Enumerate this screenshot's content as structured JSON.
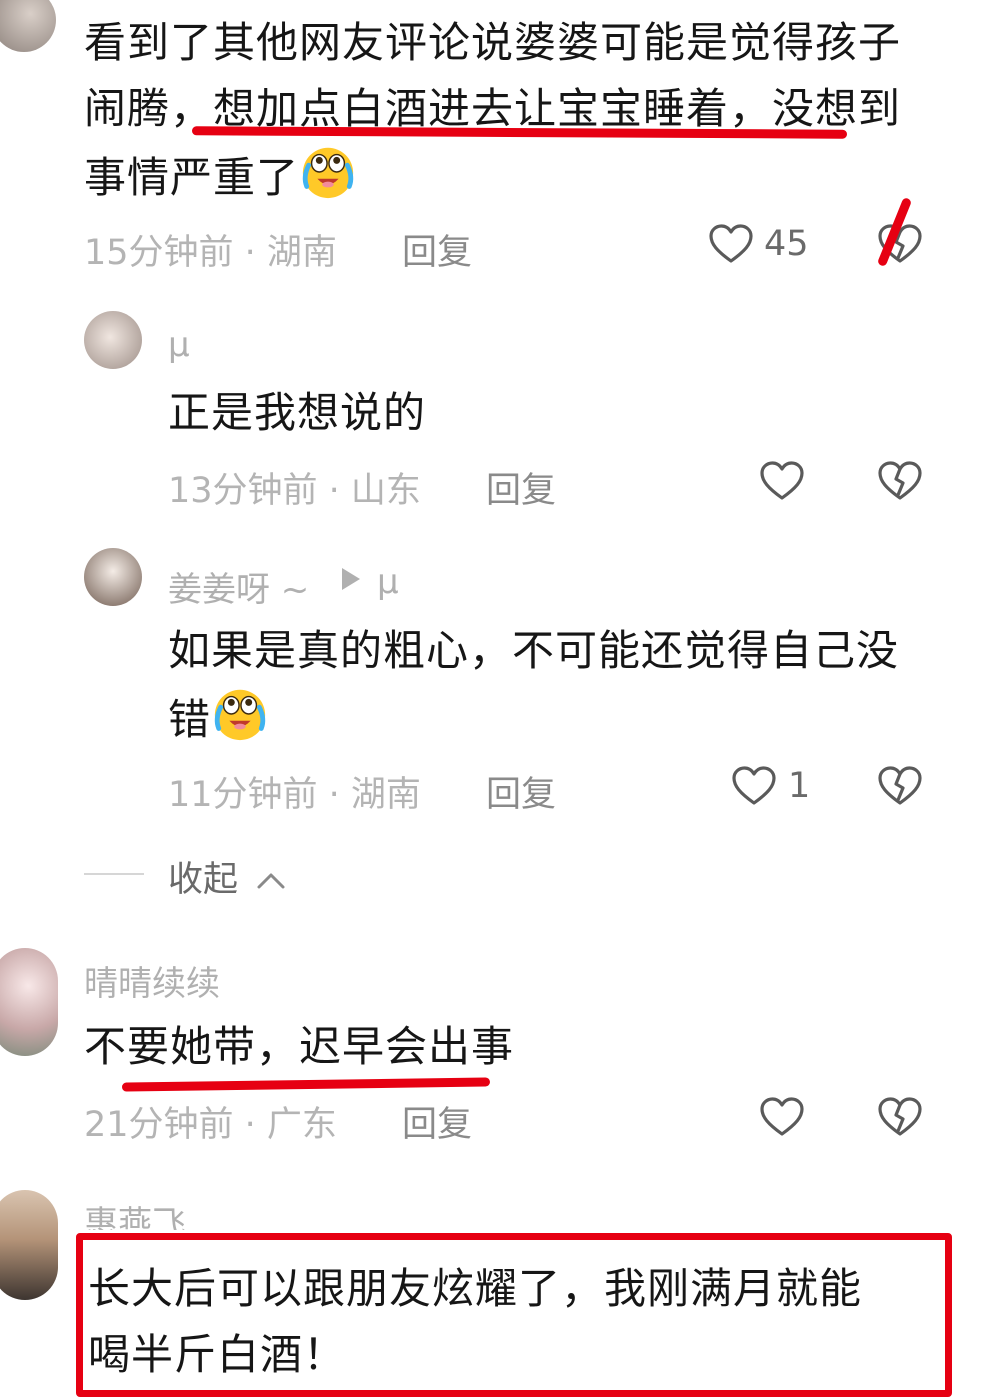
{
  "comments": [
    {
      "text": "看到了其他网友评论说婆婆可能是觉得孩子闹腾，想加点白酒进去让宝宝睡着，没想到事情严重了",
      "meta": "15分钟前 · 湖南",
      "reply_label": "回复",
      "likes": "45",
      "emoji": "crying-laughing-emoji"
    },
    {
      "username": "μ",
      "text": "正是我想说的",
      "meta": "13分钟前 · 山东",
      "reply_label": "回复"
    },
    {
      "username": "姜姜呀 ~",
      "reply_to": "μ",
      "text_line1": "如果是真的粗心，不可能还觉得自己没",
      "text_line2": "错",
      "meta": "11分钟前 · 湖南",
      "reply_label": "回复",
      "likes": "1",
      "emoji": "crying-laughing-emoji"
    },
    {
      "username": "晴晴续续",
      "text": "不要她带，迟早会出事",
      "meta": "21分钟前 · 广东",
      "reply_label": "回复"
    },
    {
      "username": "惠燕飞",
      "text_line1": "长大后可以跟朋友炫耀了，我刚满月就能",
      "text_line2": "喝半斤白酒！"
    }
  ],
  "collapse_label": "收起",
  "colors": {
    "annotation_red": "#e60012",
    "text_primary": "#161616",
    "text_secondary": "#b4b4b4"
  },
  "icons": [
    "heart-outline-icon",
    "broken-heart-icon",
    "chevron-up-icon",
    "play-triangle-icon"
  ]
}
